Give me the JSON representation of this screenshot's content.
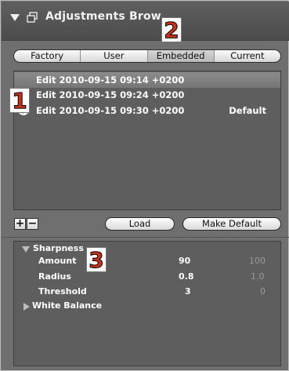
{
  "window": {
    "title": "Adjustments Brow"
  },
  "tabs": [
    {
      "label": "Factory"
    },
    {
      "label": "User"
    },
    {
      "label": "Embedded",
      "selected": true
    },
    {
      "label": "Current"
    }
  ],
  "presets": [
    {
      "label": "Edit 2010-09-15 09:14 +0200",
      "tag": "",
      "selected": true,
      "checked": false
    },
    {
      "label": "Edit 2010-09-15 09:24 +0200",
      "tag": "",
      "selected": false,
      "checked": false
    },
    {
      "label": "Edit 2010-09-15 09:30 +0200",
      "tag": "Default",
      "selected": false,
      "checked": true
    }
  ],
  "buttons": {
    "add_label": "+",
    "remove_label": "−",
    "load_label": "Load",
    "make_default_label": "Make Default"
  },
  "adjustments": {
    "sharpness": {
      "title": "Sharpness",
      "expanded": true,
      "rows": [
        {
          "name": "Amount",
          "value": "90",
          "default": "100"
        },
        {
          "name": "Radius",
          "value": "0.8",
          "default": "1.0"
        },
        {
          "name": "Threshold",
          "value": "3",
          "default": "0"
        }
      ]
    },
    "white_balance": {
      "title": "White Balance",
      "expanded": false
    }
  },
  "callouts": [
    "1",
    "2",
    "3"
  ],
  "colors": {
    "callout_text": "#c8321b",
    "panel_bg": "#5e5e5e",
    "title_bg": "#4c4c4c"
  }
}
